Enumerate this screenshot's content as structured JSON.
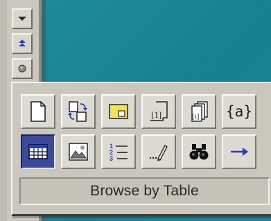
{
  "browse": {
    "status_label": "Browse by Table",
    "selected": "table",
    "objects_row1": [
      {
        "name": "page-icon"
      },
      {
        "name": "section-icon"
      },
      {
        "name": "comment-icon"
      },
      {
        "name": "footnote-icon"
      },
      {
        "name": "endnote-icon"
      },
      {
        "name": "field-icon",
        "glyph": "{a}"
      }
    ],
    "objects_row2": [
      {
        "name": "table-icon"
      },
      {
        "name": "graphic-icon"
      },
      {
        "name": "heading-icon"
      },
      {
        "name": "edits-icon"
      },
      {
        "name": "find-icon"
      },
      {
        "name": "go-to-icon"
      }
    ]
  },
  "scrollbar": {
    "buttons": [
      "scroll-down-icon",
      "previous-object-icon",
      "select-browse-object-icon"
    ]
  },
  "colors": {
    "document_background": "#1a8492",
    "selected_button": "#3c4a9a",
    "arrow_blue": "#2b3fb0"
  }
}
